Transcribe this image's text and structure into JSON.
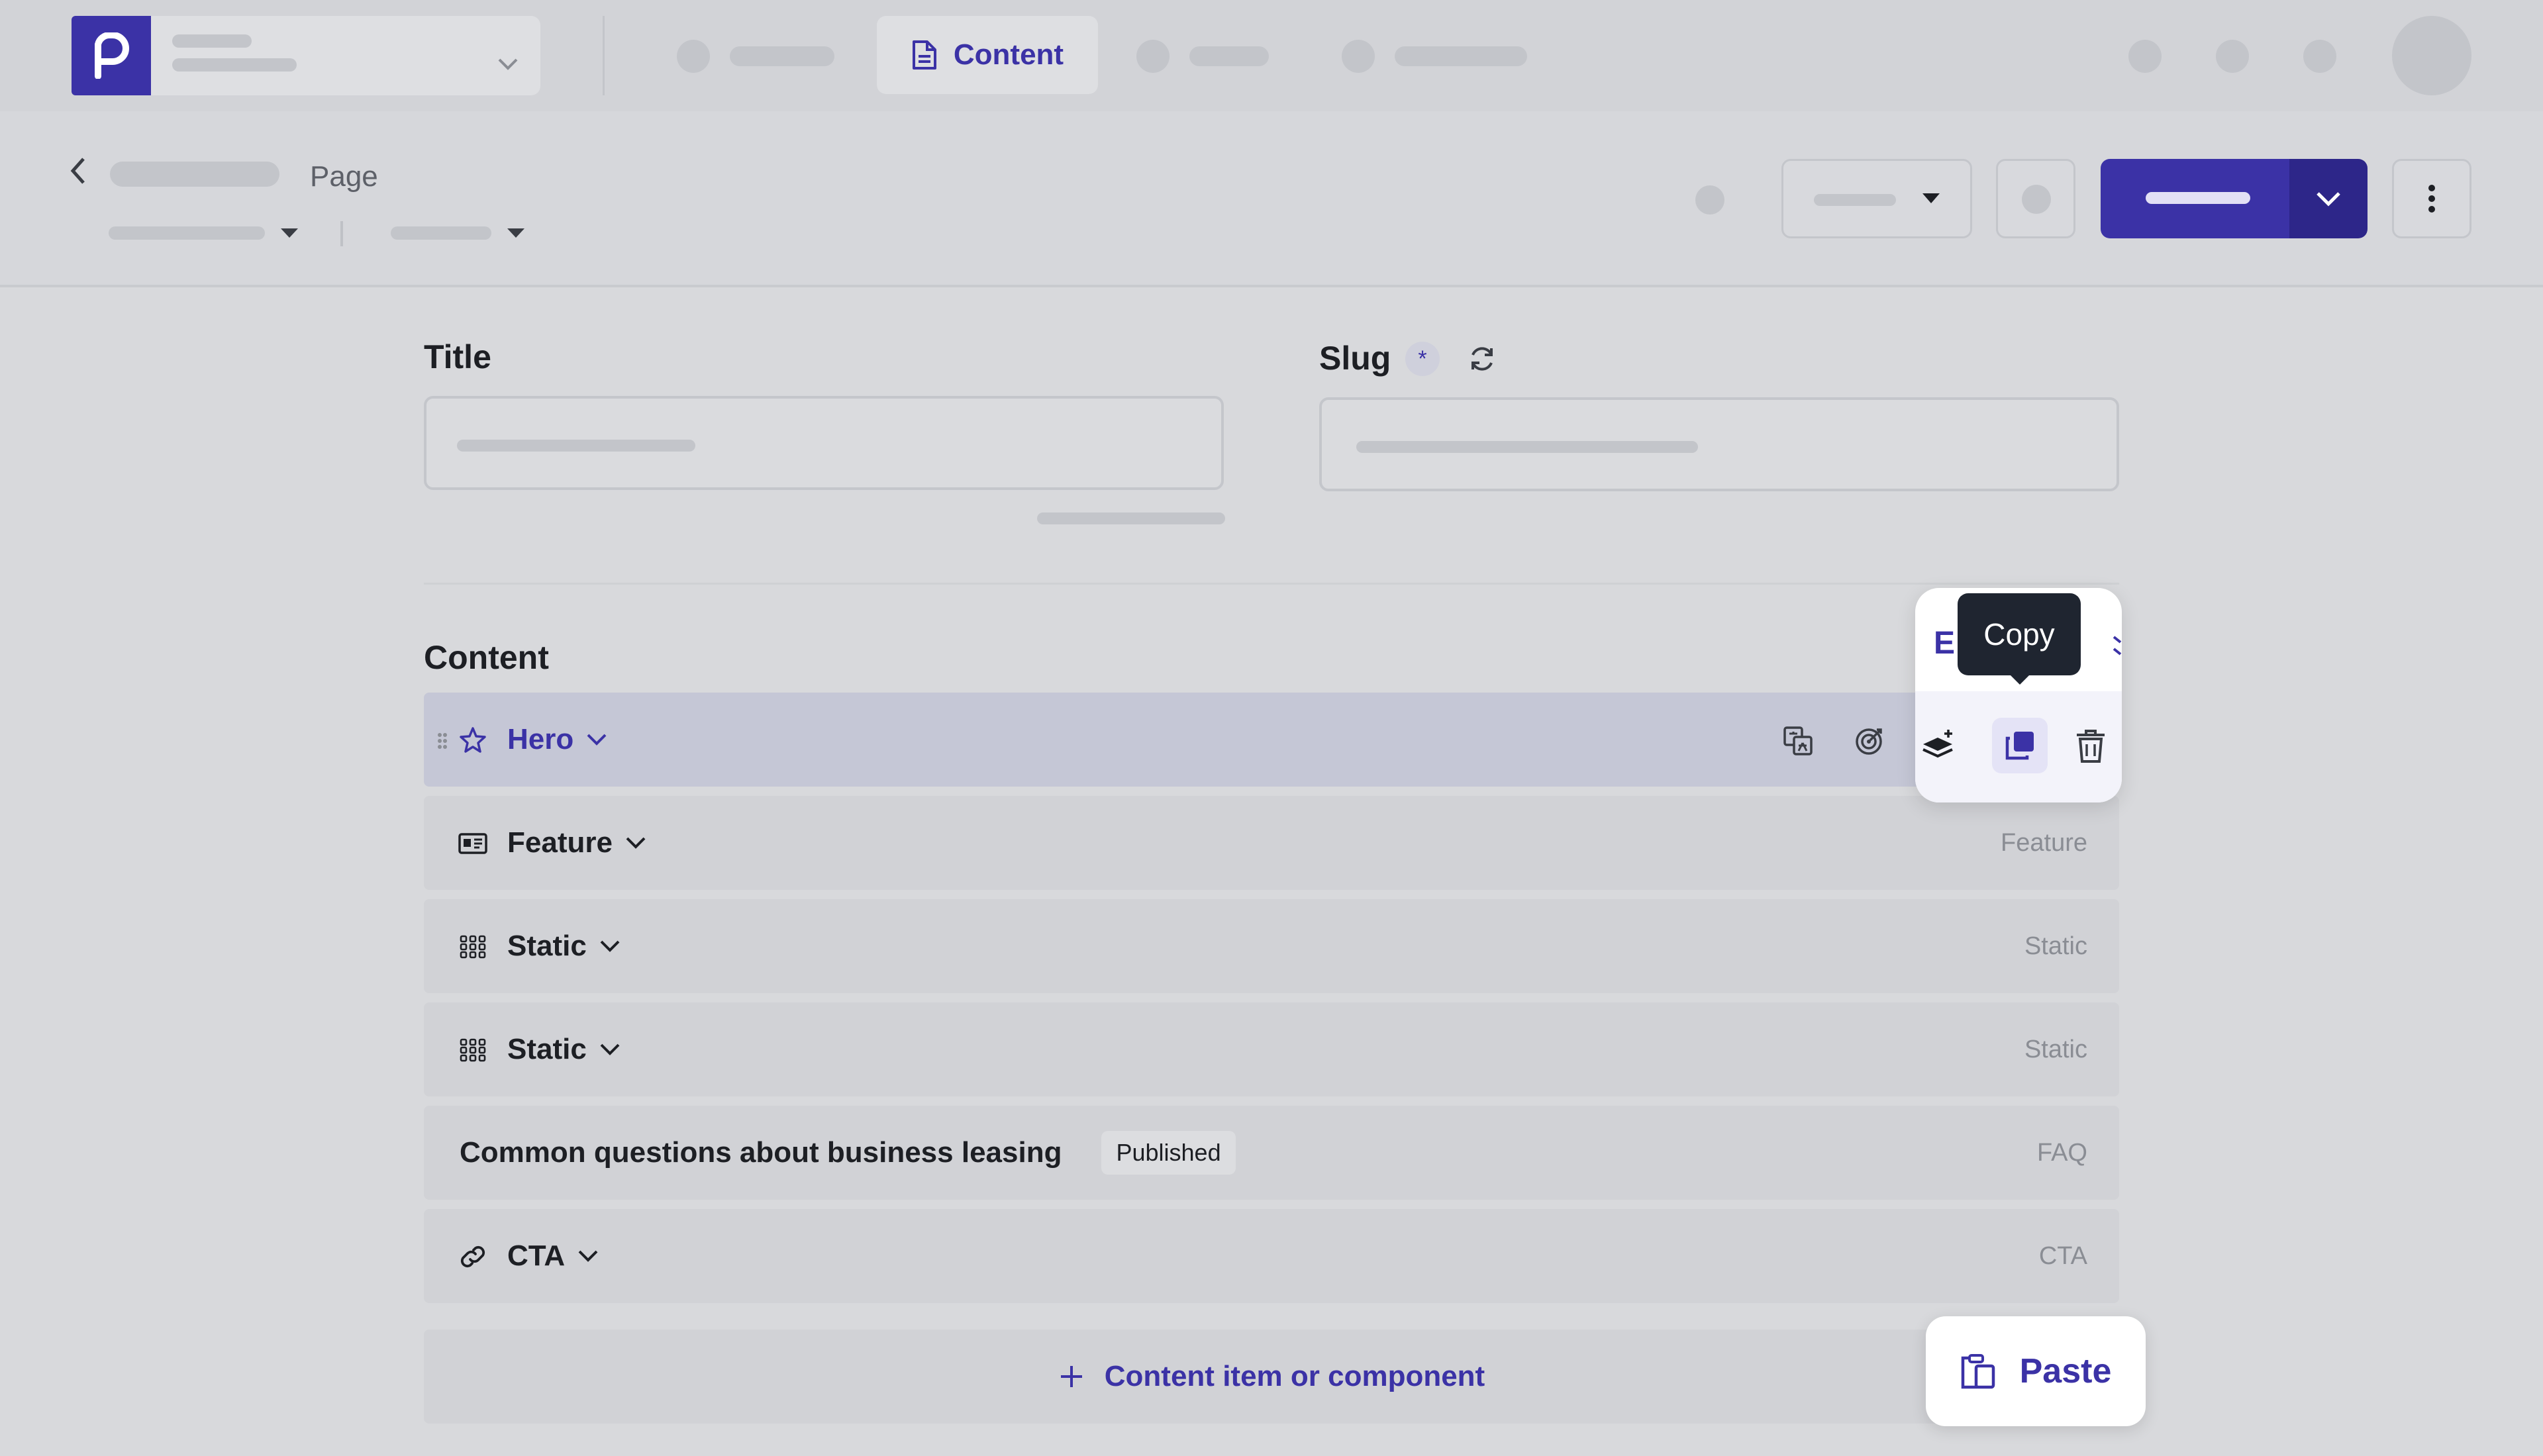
{
  "nav": {
    "active_tab": "Content"
  },
  "header": {
    "page_label": "Page"
  },
  "form": {
    "title_label": "Title",
    "slug_label": "Slug",
    "slug_required_mark": "*"
  },
  "content": {
    "heading": "Content",
    "rows": [
      {
        "name": "Hero",
        "type": "",
        "icon": "star-icon"
      },
      {
        "name": "Feature",
        "type": "Feature",
        "icon": "id-card-icon"
      },
      {
        "name": "Static",
        "type": "Static",
        "icon": "grid-icon"
      },
      {
        "name": "Static",
        "type": "Static",
        "icon": "grid-icon"
      },
      {
        "name": "Common questions about business leasing",
        "badge": "Published",
        "type": "FAQ"
      },
      {
        "name": "CTA",
        "type": "CTA",
        "icon": "link-icon"
      }
    ],
    "add_label": "Content item or component"
  },
  "popover": {
    "partial_text": "E                ll",
    "tooltip": "Copy"
  },
  "paste": {
    "label": "Paste"
  },
  "colors": {
    "brand": "#3b32a6",
    "tooltip_bg": "#1f2530"
  }
}
